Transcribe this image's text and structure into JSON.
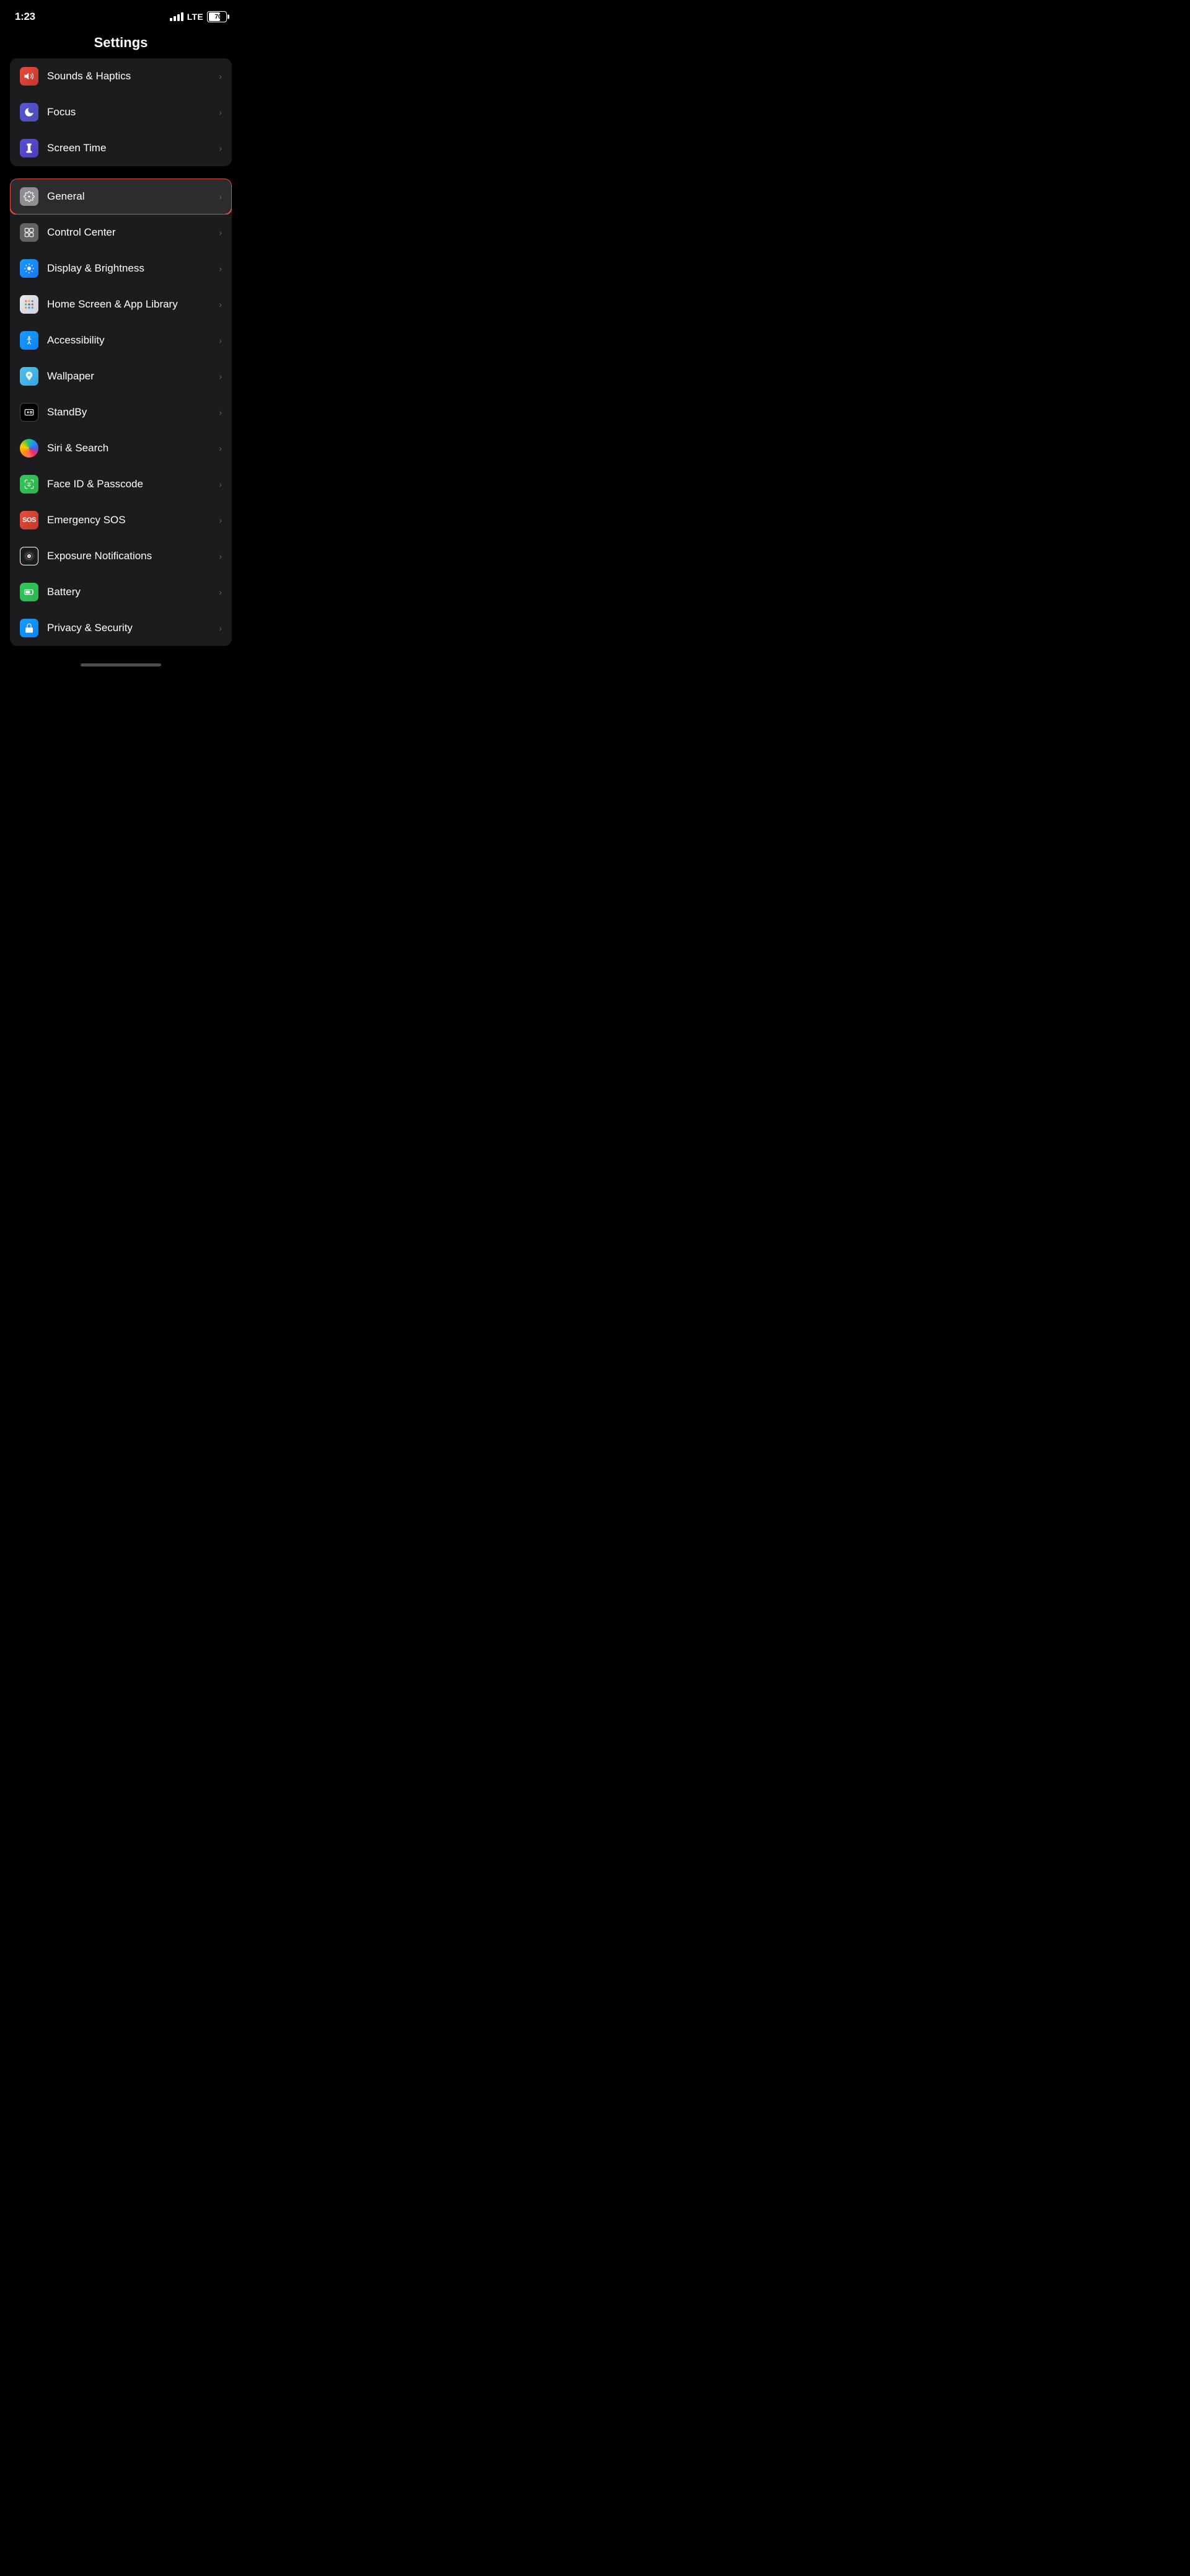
{
  "statusBar": {
    "time": "1:23",
    "lteLable": "LTE",
    "batteryPercent": "70"
  },
  "header": {
    "title": "Settings"
  },
  "sections": [
    {
      "id": "section1",
      "items": [
        {
          "id": "sounds",
          "label": "Sounds & Haptics",
          "iconClass": "icon-sounds",
          "iconType": "speaker"
        },
        {
          "id": "focus",
          "label": "Focus",
          "iconClass": "icon-focus",
          "iconType": "moon"
        },
        {
          "id": "screentime",
          "label": "Screen Time",
          "iconClass": "icon-screentime",
          "iconType": "hourglass"
        }
      ]
    },
    {
      "id": "section2",
      "items": [
        {
          "id": "general",
          "label": "General",
          "iconClass": "icon-general",
          "iconType": "gear",
          "highlighted": true
        },
        {
          "id": "controlcenter",
          "label": "Control Center",
          "iconClass": "icon-controlcenter",
          "iconType": "sliders"
        },
        {
          "id": "display",
          "label": "Display & Brightness",
          "iconClass": "icon-display",
          "iconType": "sun"
        },
        {
          "id": "homescreen",
          "label": "Home Screen & App Library",
          "iconClass": "icon-homescreen",
          "iconType": "grid"
        },
        {
          "id": "accessibility",
          "label": "Accessibility",
          "iconClass": "icon-accessibility",
          "iconType": "person"
        },
        {
          "id": "wallpaper",
          "label": "Wallpaper",
          "iconClass": "icon-wallpaper",
          "iconType": "flower"
        },
        {
          "id": "standby",
          "label": "StandBy",
          "iconClass": "icon-standby",
          "iconType": "standby"
        },
        {
          "id": "siri",
          "label": "Siri & Search",
          "iconClass": "icon-siri",
          "iconType": "siri"
        },
        {
          "id": "faceid",
          "label": "Face ID & Passcode",
          "iconClass": "icon-faceid",
          "iconType": "faceid"
        },
        {
          "id": "sos",
          "label": "Emergency SOS",
          "iconClass": "icon-sos",
          "iconType": "sos"
        },
        {
          "id": "exposure",
          "label": "Exposure Notifications",
          "iconClass": "icon-exposure",
          "iconType": "exposure"
        },
        {
          "id": "battery",
          "label": "Battery",
          "iconClass": "icon-battery",
          "iconType": "battery"
        },
        {
          "id": "privacy",
          "label": "Privacy & Security",
          "iconClass": "icon-privacy",
          "iconType": "hand"
        }
      ]
    }
  ],
  "chevron": "›"
}
